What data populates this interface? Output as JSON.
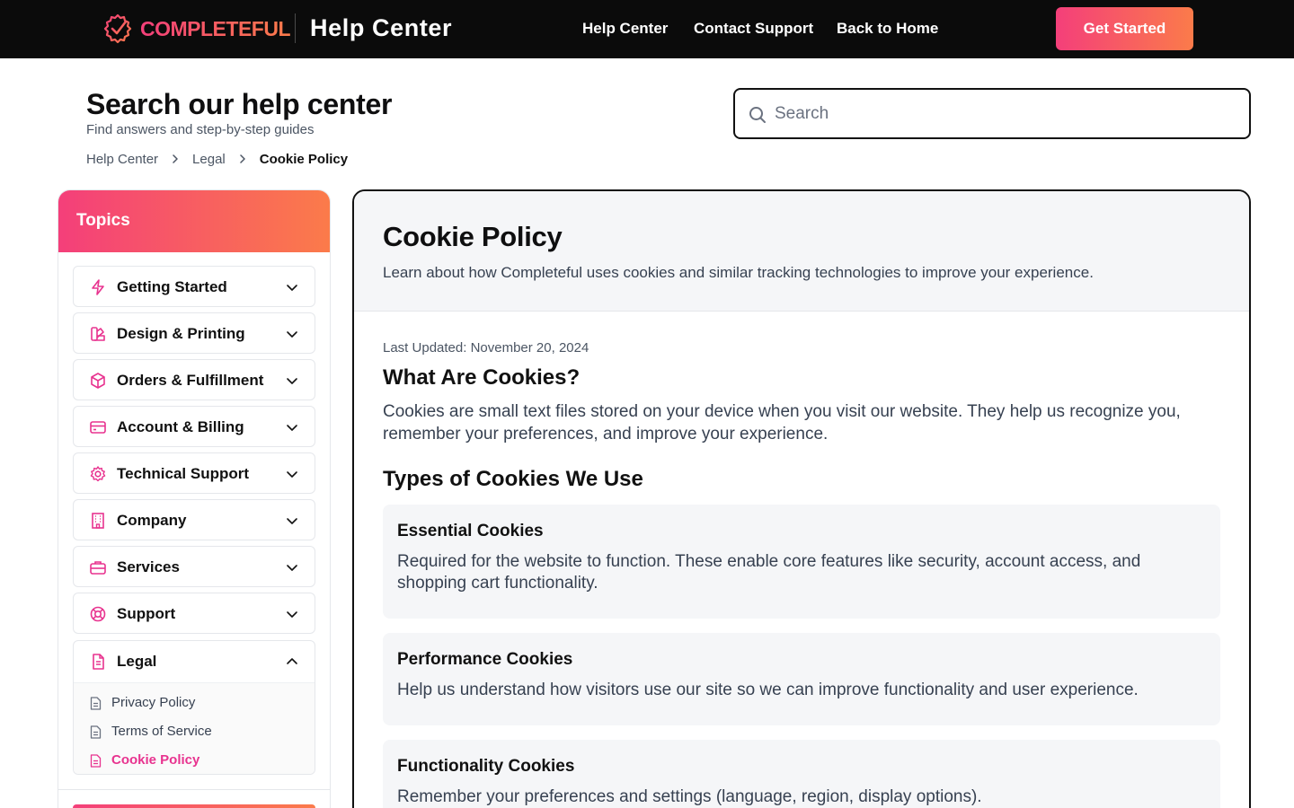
{
  "topbar": {
    "brand": "COMPLETEFUL",
    "section_title": "Help Center",
    "nav": [
      "Help Center",
      "Contact Support",
      "Back to Home"
    ],
    "cta": "Get Started"
  },
  "header": {
    "title": "Search our help center",
    "subtitle": "Find answers and step-by-step guides",
    "search_placeholder": "Search"
  },
  "breadcrumb": [
    "Help Center",
    "Legal",
    "Cookie Policy"
  ],
  "sidebar": {
    "title": "Topics",
    "topics": [
      {
        "label": "Getting Started",
        "icon": "lightning-icon"
      },
      {
        "label": "Design & Printing",
        "icon": "swatch-icon"
      },
      {
        "label": "Orders & Fulfillment",
        "icon": "box-icon"
      },
      {
        "label": "Account & Billing",
        "icon": "credit-card-icon"
      },
      {
        "label": "Technical Support",
        "icon": "gear-icon"
      },
      {
        "label": "Company",
        "icon": "building-icon"
      },
      {
        "label": "Services",
        "icon": "briefcase-icon"
      },
      {
        "label": "Support",
        "icon": "lifebuoy-icon"
      }
    ],
    "legal": {
      "label": "Legal",
      "icon": "document-icon",
      "items": [
        "Privacy Policy",
        "Terms of Service",
        "Cookie Policy"
      ],
      "active": "Cookie Policy"
    }
  },
  "article": {
    "title": "Cookie Policy",
    "description": "Learn about how Completeful uses cookies and similar tracking technologies to improve your experience.",
    "updated": "Last Updated: November 20, 2024",
    "what_heading": "What Are Cookies?",
    "what_text": "Cookies are small text files stored on your device when you visit our website. They help us recognize you, remember your preferences, and improve your experience.",
    "types_heading": "Types of Cookies We Use",
    "cookies": [
      {
        "title": "Essential Cookies",
        "text": "Required for the website to function. These enable core features like security, account access, and shopping cart functionality."
      },
      {
        "title": "Performance Cookies",
        "text": "Help us understand how visitors use our site so we can improve functionality and user experience."
      },
      {
        "title": "Functionality Cookies",
        "text": "Remember your preferences and settings (language, region, display options)."
      }
    ]
  },
  "colors": {
    "accent_start": "#f43f7a",
    "accent_end": "#fb7b4a",
    "active_link": "#e8338f",
    "topbar": "#0b0b0b"
  }
}
